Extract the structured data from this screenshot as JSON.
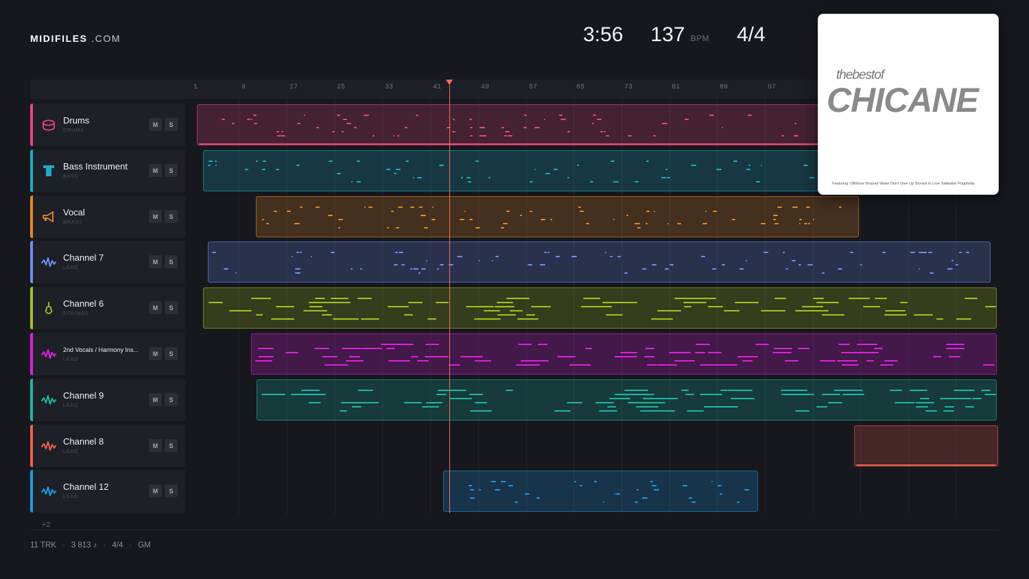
{
  "brand": {
    "name_bold": "MIDIFILES",
    "name_suffix": " .COM"
  },
  "transport": {
    "time": "3:56",
    "bpm": "137",
    "bpm_unit": "BPM",
    "signature": "4/4"
  },
  "timeline": {
    "bars": [
      "1",
      "9",
      "17",
      "25",
      "33",
      "41",
      "49",
      "57",
      "65",
      "73",
      "81",
      "89",
      "97"
    ]
  },
  "tracks": [
    {
      "name": "Drums",
      "type": "DRUMS",
      "color": "#e8497a",
      "icon": "drum-icon",
      "mute": "M",
      "solo": "S"
    },
    {
      "name": "Bass Instrument",
      "type": "BASS",
      "color": "#1aaec4",
      "icon": "bass-icon",
      "mute": "M",
      "solo": "S"
    },
    {
      "name": "Vocal",
      "type": "BRASS",
      "color": "#e98a1f",
      "icon": "trumpet-icon",
      "mute": "M",
      "solo": "S"
    },
    {
      "name": "Channel 7",
      "type": "LEAD",
      "color": "#6f8ef0",
      "icon": "waveform-icon",
      "mute": "M",
      "solo": "S"
    },
    {
      "name": "Channel 6",
      "type": "STRINGS",
      "color": "#a6c21c",
      "icon": "violin-icon",
      "mute": "M",
      "solo": "S"
    },
    {
      "name": "2nd Vocals / Harmony Ins...",
      "type": "LEAD",
      "color": "#e01ee0",
      "icon": "waveform-icon",
      "mute": "M",
      "solo": "S"
    },
    {
      "name": "Channel 9",
      "type": "LEAD",
      "color": "#1cb8a3",
      "icon": "waveform-icon",
      "mute": "M",
      "solo": "S"
    },
    {
      "name": "Channel 8",
      "type": "LEAD",
      "color": "#f0604e",
      "icon": "waveform-icon",
      "mute": "M",
      "solo": "S"
    },
    {
      "name": "Channel 12",
      "type": "LEAD",
      "color": "#1a9ce8",
      "icon": "waveform-icon",
      "mute": "M",
      "solo": "S"
    }
  ],
  "more_tracks": "+2",
  "footer": {
    "tracks": "11 TRK",
    "notes": "3 813 ♪",
    "signature": "4/4",
    "standard": "GM"
  },
  "album": {
    "subtitle": "thebestof",
    "title": "CHICANE",
    "featuring": "Featuring:  Offshore  Bruised Water  Don't Give Up  Stoned in Love  Saltwater  Poppholla"
  }
}
